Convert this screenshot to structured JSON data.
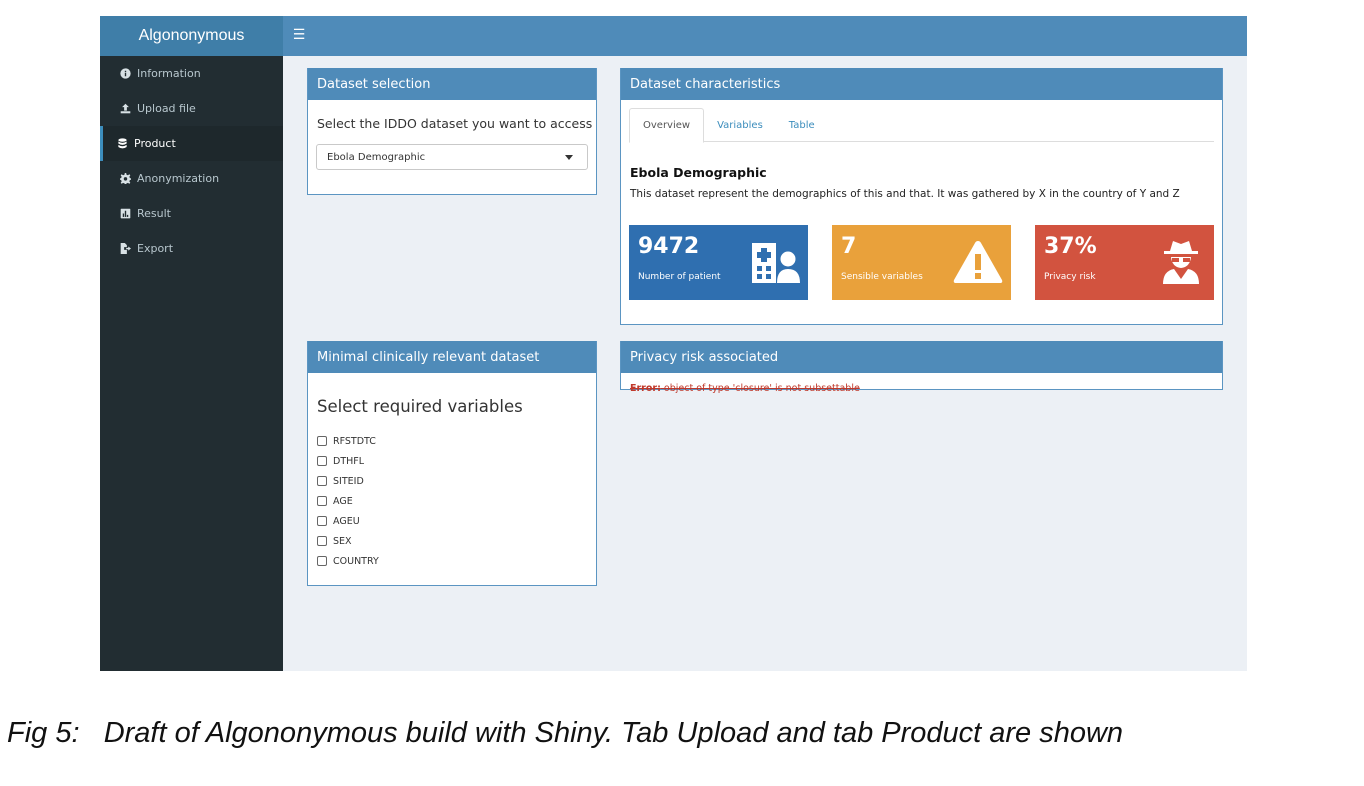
{
  "app": {
    "title": "Algononymous"
  },
  "header": {
    "menu_icon": "hamburger-icon"
  },
  "sidebar": {
    "items": [
      {
        "label": "Information",
        "icon": "info-circle-icon",
        "active": false
      },
      {
        "label": "Upload file",
        "icon": "upload-icon",
        "active": false
      },
      {
        "label": "Product",
        "icon": "database-icon",
        "active": true
      },
      {
        "label": "Anonymization",
        "icon": "gear-icon",
        "active": false
      },
      {
        "label": "Result",
        "icon": "chart-icon",
        "active": false
      },
      {
        "label": "Export",
        "icon": "file-export-icon",
        "active": false
      }
    ]
  },
  "dataset_selection": {
    "title": "Dataset selection",
    "prompt": "Select the IDDO dataset you want to access",
    "selected": "Ebola Demographic"
  },
  "dataset_characteristics": {
    "title": "Dataset characteristics",
    "tabs": [
      {
        "label": "Overview",
        "active": true
      },
      {
        "label": "Variables",
        "active": false
      },
      {
        "label": "Table",
        "active": false
      }
    ],
    "name": "Ebola Demographic",
    "description": "This dataset represent the demographics of this and that. It was gathered by X in the country of Y and Z",
    "value_boxes": [
      {
        "value": "9472",
        "label": "Number of patient",
        "color": "#2f6fb0",
        "icon": "hospital-user-icon"
      },
      {
        "value": "7",
        "label": "Sensible variables",
        "color": "#e9a13b",
        "icon": "warning-icon"
      },
      {
        "value": "37%",
        "label": "Privacy risk",
        "color": "#d2533f",
        "icon": "user-secret-icon"
      }
    ]
  },
  "minimal_dataset": {
    "title": "Minimal clinically relevant dataset",
    "heading": "Select required variables",
    "variables": [
      "RFSTDTC",
      "DTHFL",
      "SITEID",
      "AGE",
      "AGEU",
      "SEX",
      "COUNTRY"
    ]
  },
  "privacy_risk": {
    "title": "Privacy risk associated",
    "error_prefix": "Error:",
    "error_message": " object of type 'closure' is not subsettable"
  },
  "caption": "Fig 5:   Draft of Algononymous build with Shiny. Tab Upload and tab Product are shown"
}
